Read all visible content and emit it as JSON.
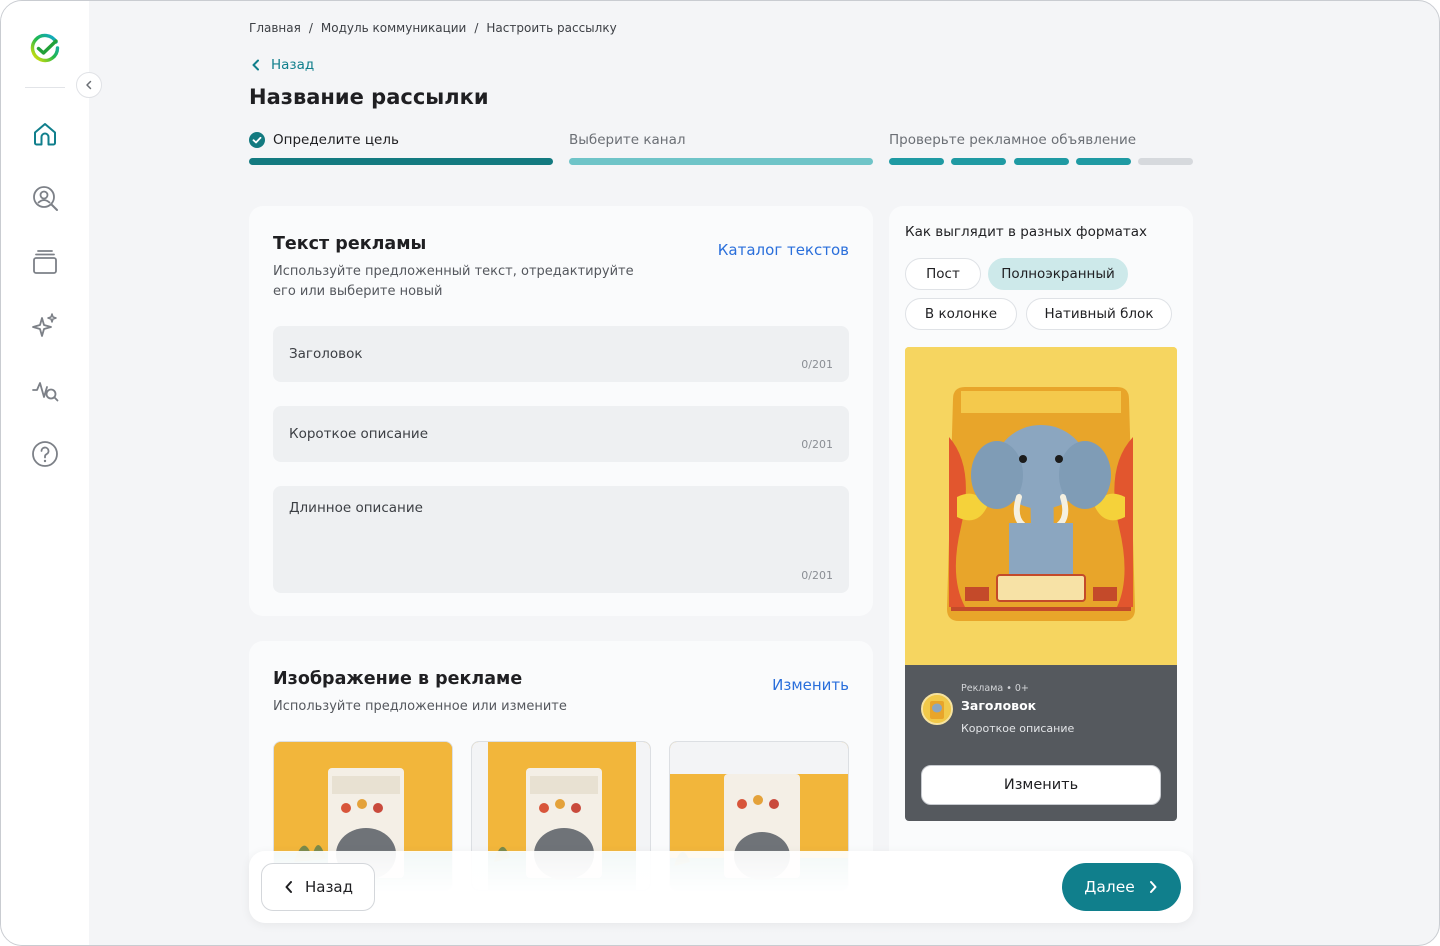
{
  "breadcrumb": [
    "Главная",
    "Модуль коммуникации",
    "Настроить рассылку"
  ],
  "back_label": "Назад",
  "page_title": "Название рассылки",
  "steps": [
    {
      "label": "Определите цель",
      "state": "done"
    },
    {
      "label": "Выберите канал",
      "state": "current"
    },
    {
      "label": "Проверьте рекламное объявление",
      "state": "upcoming",
      "segments_progress": 0.8
    }
  ],
  "ad_text": {
    "title": "Текст рекламы",
    "subtitle_line1": "Используйте предложенный текст, отредактируйте",
    "subtitle_line2": "его или выберите новый",
    "catalog_link": "Каталог текстов",
    "fields": [
      {
        "label": "Заголовок",
        "count": "0/201"
      },
      {
        "label": "Короткое описание",
        "count": "0/201"
      },
      {
        "label": "Длинное описание",
        "count": "0/201"
      }
    ]
  },
  "ad_image": {
    "title": "Изображение в рекламе",
    "subtitle": "Используйте предложенное или измените",
    "change_link": "Изменить"
  },
  "preview": {
    "title": "Как выглядит в разных форматах",
    "formats": [
      {
        "label": "Пост",
        "active": false
      },
      {
        "label": "Полноэкранный",
        "active": true
      },
      {
        "label": "В колонке",
        "active": false
      },
      {
        "label": "Нативный блок",
        "active": false
      }
    ],
    "meta": "Реклама • 0+",
    "headline": "Заголовок",
    "description": "Короткое описание",
    "button": "Изменить"
  },
  "footer": {
    "back": "Назад",
    "next": "Далее"
  },
  "colors": {
    "primary": "#107f8c",
    "step_done": "#137a80",
    "step_current": "#6fc4c8",
    "link": "#2a6fdb",
    "chip_active": "#cde9ea"
  }
}
